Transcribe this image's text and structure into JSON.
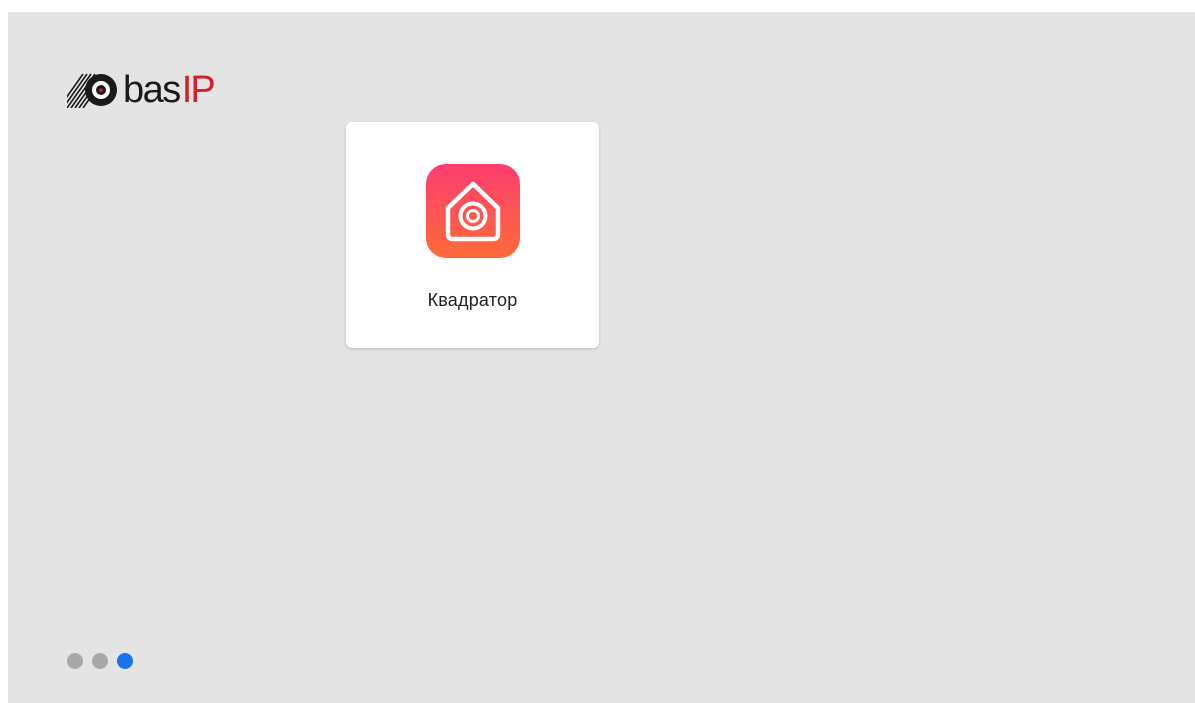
{
  "logo": {
    "text_main": "bas",
    "text_accent": "IP",
    "icon": "basip-logo-icon",
    "accent_color": "#d5202a"
  },
  "apps": [
    {
      "label": "Квадратор",
      "icon": "home-camera-icon",
      "gradient": [
        "#fc3d6e",
        "#ff6a3a"
      ]
    }
  ],
  "pager": {
    "pages": 3,
    "active_index": 2,
    "active_color": "#1a73e8",
    "inactive_color": "#a8a8a8"
  },
  "colors": {
    "background": "#e4e4e4",
    "card": "#ffffff"
  }
}
